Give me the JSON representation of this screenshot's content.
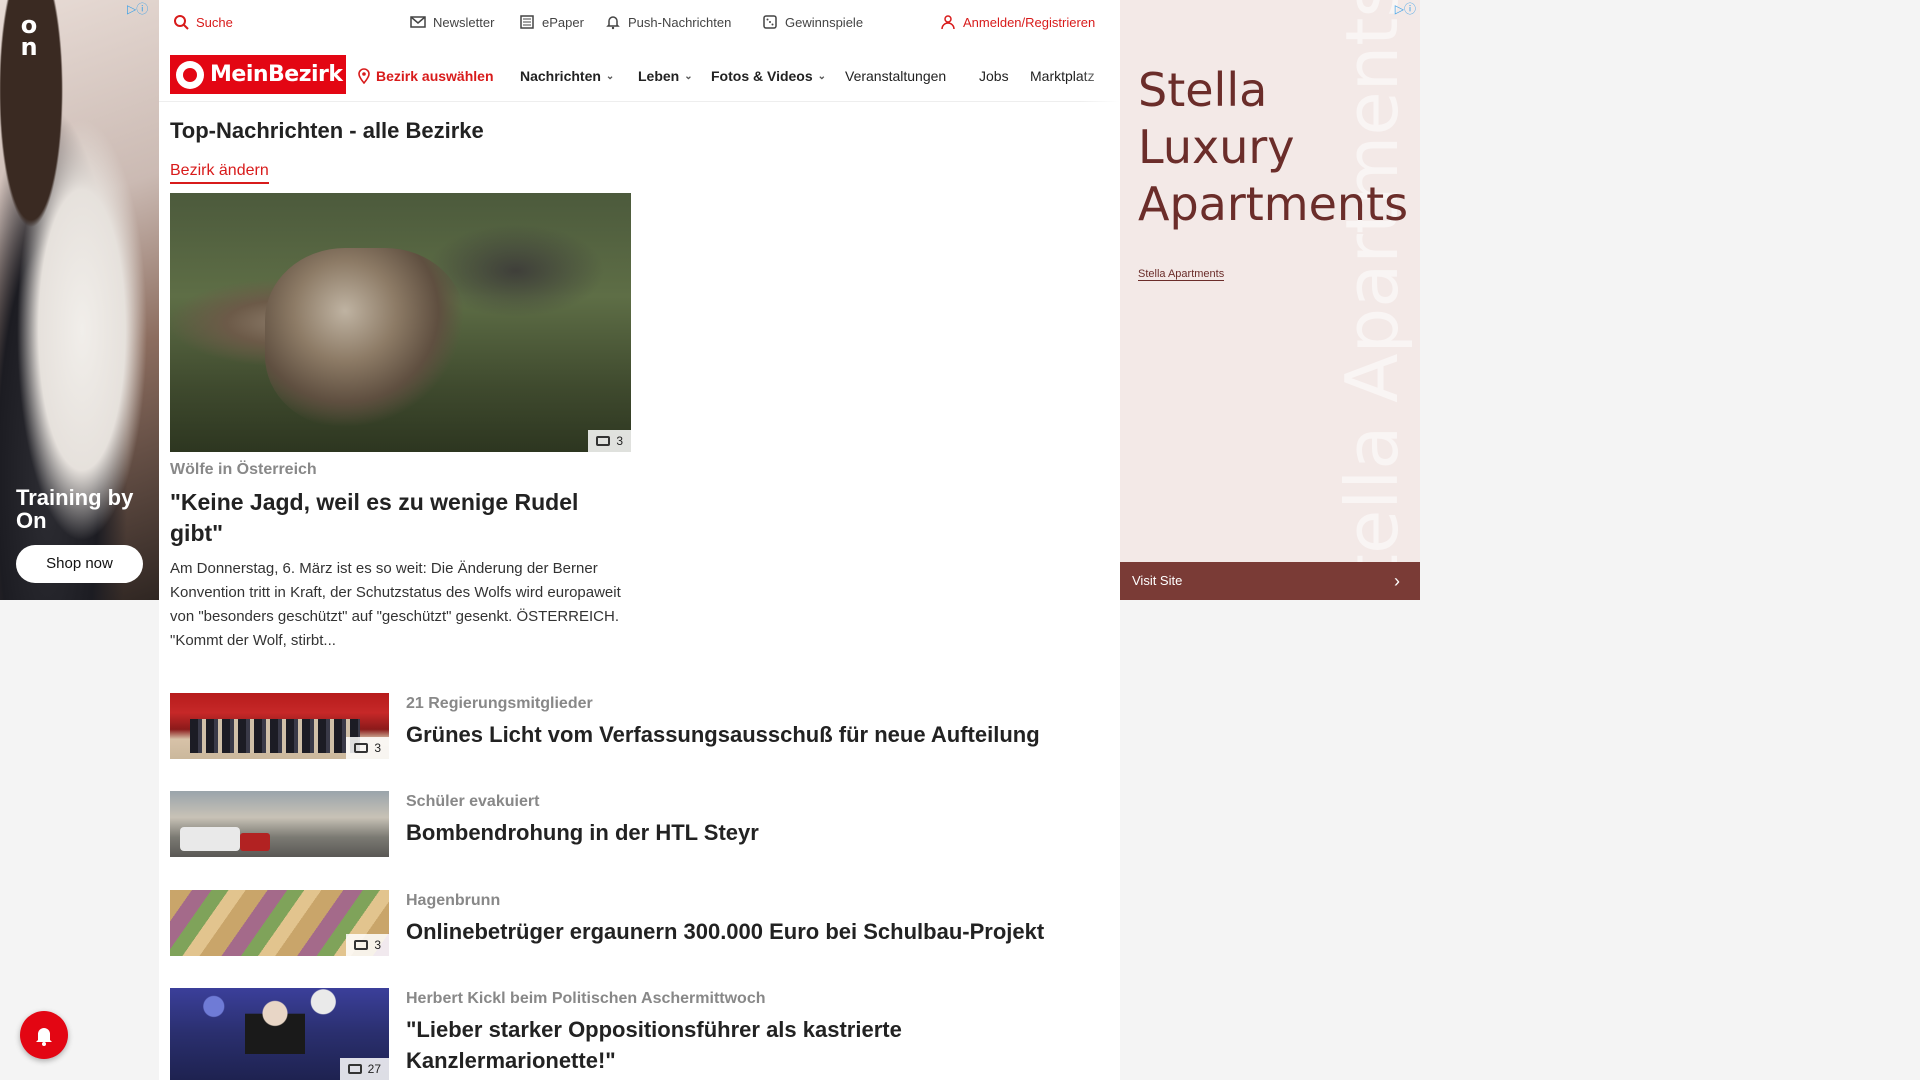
{
  "ads": {
    "left": {
      "headline": "Training by On",
      "button": "Shop now",
      "brand": "On"
    },
    "right": {
      "headline": "Stella Luxury Apartments",
      "advertiser_link": "Stella Apartments",
      "cta": "Visit Site",
      "watermark": "Stella Apartments",
      "accent_color": "#7a3b36"
    }
  },
  "utility_bar": {
    "search": "Suche",
    "newsletter": "Newsletter",
    "epaper": "ePaper",
    "push": "Push-Nachrichten",
    "gewinnspiele": "Gewinnspiele",
    "login": "Anmelden/Registrieren"
  },
  "nav": {
    "logo": "MeinBezirk",
    "bezirk": "Bezirk auswählen",
    "items": [
      "Nachrichten",
      "Leben",
      "Fotos & Videos",
      "Veranstaltungen",
      "Jobs",
      "Marktplatz"
    ]
  },
  "section": {
    "title": "Top-Nachrichten - alle Bezirke",
    "change_link": "Bezirk ändern"
  },
  "hero": {
    "image_count": "3",
    "kicker": "Wölfe in Österreich",
    "title": "\"Keine Jagd, weil es zu wenige Rudel gibt\"",
    "teaser": "Am Donnerstag, 6. März ist es so weit: Die Änderung der Berner Konvention tritt in Kraft, der Schutzstatus des Wolfs wird europaweit von \"besonders geschützt\" auf \"geschützt\" gesenkt.  ÖSTERREICH. \"Kommt der Wolf, stirbt..."
  },
  "articles": [
    {
      "kicker": "21 Regierungsmitglieder",
      "title": "Grünes Licht vom Verfassungsausschuß für neue Aufteilung",
      "image_count": "3"
    },
    {
      "kicker": "Schüler evakuiert",
      "title": "Bombendrohung in der HTL Steyr",
      "image_count": ""
    },
    {
      "kicker": "Hagenbrunn",
      "title": "Onlinebetrüger ergaunern 300.000 Euro bei Schulbau-Projekt",
      "image_count": "3"
    },
    {
      "kicker": "Herbert Kickl beim Politischen Aschermittwoch",
      "title": "\"Lieber starker Oppositionsführer als kastrierte Kanzlermarionette!\"",
      "image_count": "27"
    }
  ],
  "colors": {
    "brand_red": "#e30613",
    "link_red": "#d81b1b"
  }
}
